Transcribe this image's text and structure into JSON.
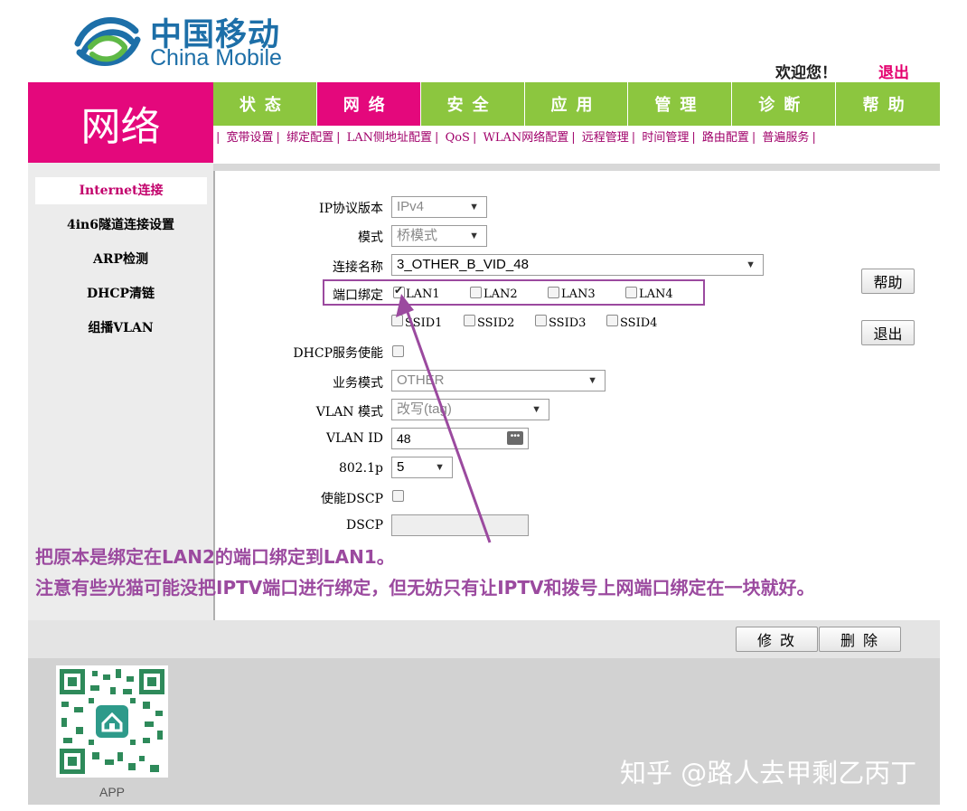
{
  "header": {
    "logo_cn": "中国移动",
    "logo_en": "China Mobile",
    "welcome": "欢迎您！",
    "logout": "退出"
  },
  "section_title": "网络",
  "nav": {
    "tabs": [
      {
        "label": "状态"
      },
      {
        "label": "网络"
      },
      {
        "label": "安全"
      },
      {
        "label": "应用"
      },
      {
        "label": "管理"
      },
      {
        "label": "诊断"
      },
      {
        "label": "帮助"
      }
    ],
    "active_index": 1
  },
  "subnav": {
    "items": [
      "宽带设置",
      "绑定配置",
      "LAN侧地址配置",
      "QoS",
      "WLAN网络配置",
      "远程管理",
      "时间管理",
      "路由配置",
      "普遍服务"
    ]
  },
  "sidebar": {
    "items": [
      {
        "label": "Internet连接"
      },
      {
        "label": "4in6隧道连接设置"
      },
      {
        "label": "ARP检测"
      },
      {
        "label": "DHCP清链"
      },
      {
        "label": "组播VLAN"
      }
    ],
    "active_index": 0
  },
  "form": {
    "ip_version": {
      "label": "IP协议版本",
      "value": "IPv4"
    },
    "mode": {
      "label": "模式",
      "value": "桥模式"
    },
    "conn_name": {
      "label": "连接名称",
      "value": "3_OTHER_B_VID_48"
    },
    "port_binding": {
      "label": "端口绑定",
      "lan": [
        {
          "label": "LAN1",
          "checked": true
        },
        {
          "label": "LAN2",
          "checked": false
        },
        {
          "label": "LAN3",
          "checked": false
        },
        {
          "label": "LAN4",
          "checked": false
        }
      ],
      "ssid": [
        {
          "label": "SSID1",
          "checked": false
        },
        {
          "label": "SSID2",
          "checked": false
        },
        {
          "label": "SSID3",
          "checked": false
        },
        {
          "label": "SSID4",
          "checked": false
        }
      ]
    },
    "dhcp_enable": {
      "label": "DHCP服务使能"
    },
    "service_mode": {
      "label": "业务模式",
      "value": "OTHER"
    },
    "vlan_mode": {
      "label": "VLAN 模式",
      "value": "改写(tag)"
    },
    "vlan_id": {
      "label": "VLAN ID",
      "value": "48"
    },
    "dot1p": {
      "label": "802.1p",
      "value": "5"
    },
    "dscp_enable": {
      "label": "使能DSCP"
    },
    "dscp": {
      "label": "DSCP",
      "value": ""
    }
  },
  "buttons": {
    "help": "帮助",
    "exit": "退出",
    "modify": "修 改",
    "delete": "删 除"
  },
  "annotation": {
    "line1": "把原本是绑定在LAN2的端口绑定到LAN1。",
    "line2": "注意有些光猫可能没把IPTV端口进行绑定，但无妨只有让IPTV和拨号上网端口绑定在一块就好。"
  },
  "footer": {
    "app_label": "APP",
    "watermark": "知乎 @路人去甲剩乙丙丁"
  },
  "colors": {
    "brand_magenta": "#e4087c",
    "nav_green": "#8cc63f",
    "annotation_purple": "#9b4a9f",
    "logo_blue": "#1d6fa8"
  }
}
